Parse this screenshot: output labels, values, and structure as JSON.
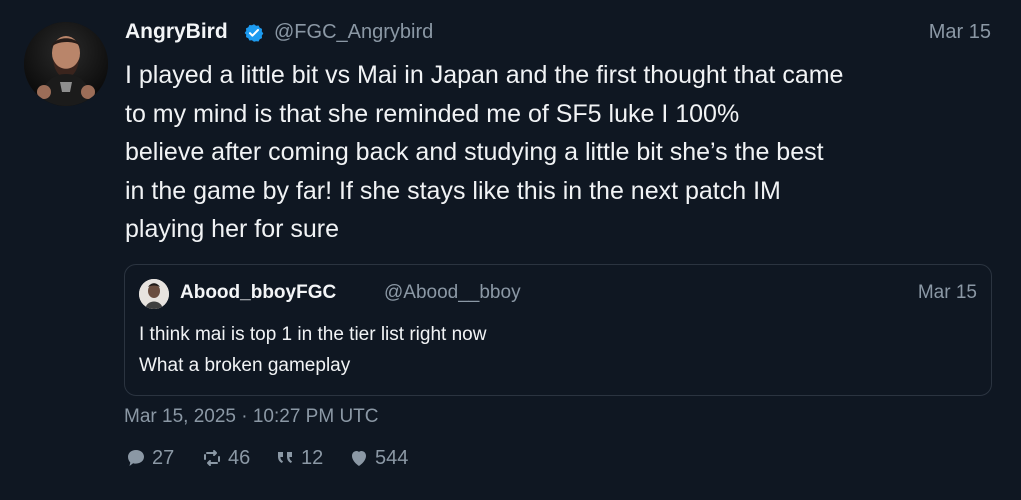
{
  "tweet": {
    "author": {
      "display_name": "AngryBird",
      "handle": "@FGC_Angrybird",
      "verified": true
    },
    "date": "Mar 15",
    "text_lines": [
      "I played a little bit vs Mai in Japan and the first thought that came",
      "to my mind is that she reminded me of SF5 luke     I 100%",
      "believe after coming back and studying a little bit she’s the best",
      "in the game by far! If she stays like this in the next patch IM",
      "playing her for sure"
    ],
    "quote": {
      "display_name": "Abood_bboyFGC",
      "handle": "@Abood__bboy",
      "date": "Mar 15",
      "text_lines": [
        "I think mai is top 1 in the tier list right now",
        "What a broken gameplay"
      ]
    },
    "timestamp": "Mar 15, 2025 · 10:27 PM UTC",
    "metrics": {
      "replies": "27",
      "retweets": "46",
      "quotes": "12",
      "likes": "544"
    }
  },
  "colors": {
    "background": "#0f1722",
    "text_primary": "#f1f3f5",
    "text_secondary": "#8b98a5",
    "border": "#2b3440",
    "verified_blue": "#1d9bf0"
  },
  "icons": {
    "avatar": "avatar",
    "verified": "verified-badge-icon",
    "quote_avatar": "avatar",
    "reply": "reply-icon",
    "retweet": "retweet-icon",
    "quote": "quote-icon",
    "like": "heart-icon"
  }
}
